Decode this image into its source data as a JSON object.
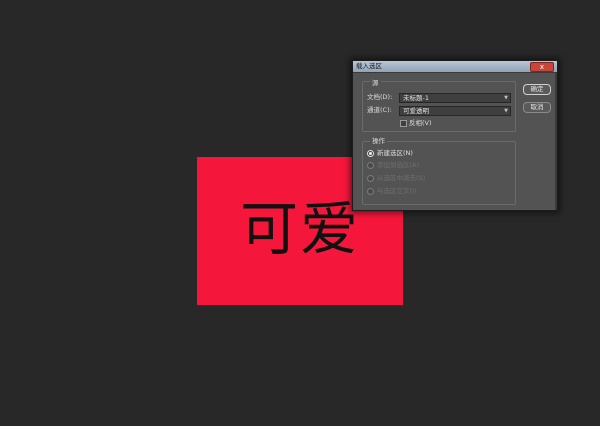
{
  "canvas": {
    "text": "可爱",
    "background": "#f5173b",
    "app_background": "#282828"
  },
  "dialog": {
    "title": "载入选区",
    "close_glyph": "x",
    "source": {
      "group_label": "源",
      "document_label": "文档(D):",
      "document_value": "未标题-1",
      "channel_label": "通道(C):",
      "channel_value": "可爱透明",
      "invert_label": "反相(V)"
    },
    "operation": {
      "group_label": "操作",
      "options": [
        {
          "label": "新建选区(N)",
          "selected": true,
          "enabled": true
        },
        {
          "label": "添加到选区(A)",
          "selected": false,
          "enabled": false
        },
        {
          "label": "从选区中减去(S)",
          "selected": false,
          "enabled": false
        },
        {
          "label": "与选区交叉(I)",
          "selected": false,
          "enabled": false
        }
      ]
    },
    "buttons": {
      "ok": "确定",
      "cancel": "取消"
    }
  }
}
